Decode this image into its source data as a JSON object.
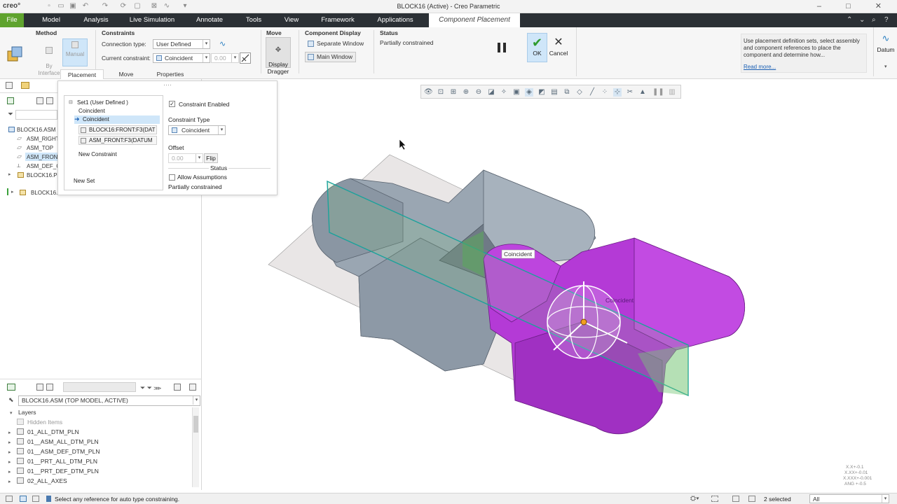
{
  "window": {
    "app_logo": "creo°",
    "title": "BLOCK16 (Active) - Creo Parametric",
    "controls": [
      "–",
      "□",
      "✕"
    ]
  },
  "tabs": [
    {
      "label": "File"
    },
    {
      "label": "Model"
    },
    {
      "label": "Analysis"
    },
    {
      "label": "Live Simulation"
    },
    {
      "label": "Annotate"
    },
    {
      "label": "Tools"
    },
    {
      "label": "View"
    },
    {
      "label": "Framework"
    },
    {
      "label": "Applications"
    },
    {
      "label": "Component Placement"
    }
  ],
  "ribbon": {
    "method": {
      "title": "Method",
      "by_interface": "By\nInterface",
      "manual": "Manual"
    },
    "constraints": {
      "title": "Constraints",
      "connection_type_label": "Connection type:",
      "connection_type_value": "User Defined",
      "current_constraint_label": "Current constraint:",
      "current_constraint_value": "Coincident",
      "offset_value": "0.00"
    },
    "move": {
      "title": "Move",
      "display_dragger": "Display\nDragger"
    },
    "component_display": {
      "title": "Component Display",
      "separate_window": "Separate Window",
      "main_window": "Main Window"
    },
    "status": {
      "title": "Status",
      "value": "Partially constrained"
    },
    "ok_label": "OK",
    "cancel_label": "Cancel",
    "datum_label": "Datum",
    "help_text": "Use placement definition sets, select assembly and component references to place the component and determine how...",
    "read_more": "Read more..."
  },
  "subtabs": [
    "Placement",
    "Move",
    "Properties"
  ],
  "placement_panel": {
    "set_label": "Set1 (User Defined )",
    "set_constraint": "Coincident",
    "selected_constraint": "Coincident",
    "ref1": "BLOCK16:FRONT:F3(DAT",
    "ref2": "ASM_FRONT:F3(DATUM",
    "new_constraint": "New Constraint",
    "new_set": "New Set",
    "constraint_enabled": "Constraint Enabled",
    "constraint_type_label": "Constraint Type",
    "constraint_type_value": "Coincident",
    "offset_label": "Offset",
    "offset_value": "0.00",
    "flip": "Flip",
    "status_label": "Status",
    "allow_assumptions": "Allow Assumptions",
    "status_value": "Partially constrained"
  },
  "model_tree": [
    "BLOCK16.ASM",
    "ASM_RIGHT",
    "ASM_TOP",
    "ASM_FRONT",
    "ASM_DEF_C",
    "BLOCK16.PR",
    "BLOCK16.I"
  ],
  "layers": {
    "model_select": "BLOCK16.ASM (TOP MODEL, ACTIVE)",
    "header": "Layers",
    "items": [
      "Hidden Items",
      "01_ALL_DTM_PLN",
      "01__ASM_ALL_DTM_PLN",
      "01__ASM_DEF_DTM_PLN",
      "01__PRT_ALL_DTM_PLN",
      "01__PRT_DEF_DTM_PLN",
      "02_ALL_AXES"
    ]
  },
  "viewport": {
    "callout1": "Coincident",
    "callout2": "Coincident",
    "coords": [
      "X.X+-0.1",
      "X.XX+-0.01",
      "X.XXX+-0.001",
      "ANG +-0.5"
    ]
  },
  "statusbar": {
    "message": "Select any reference for auto type constraining.",
    "selected": "2 selected",
    "filter_value": "All"
  },
  "colors": {
    "file_tab": "#5fa32e",
    "tab_bar": "#2b3035",
    "selection": "#cfe6f9",
    "component_magenta": "#b43ad6",
    "assembly_gray": "#9aa6b2",
    "datum_cyan": "#1aa29b"
  }
}
